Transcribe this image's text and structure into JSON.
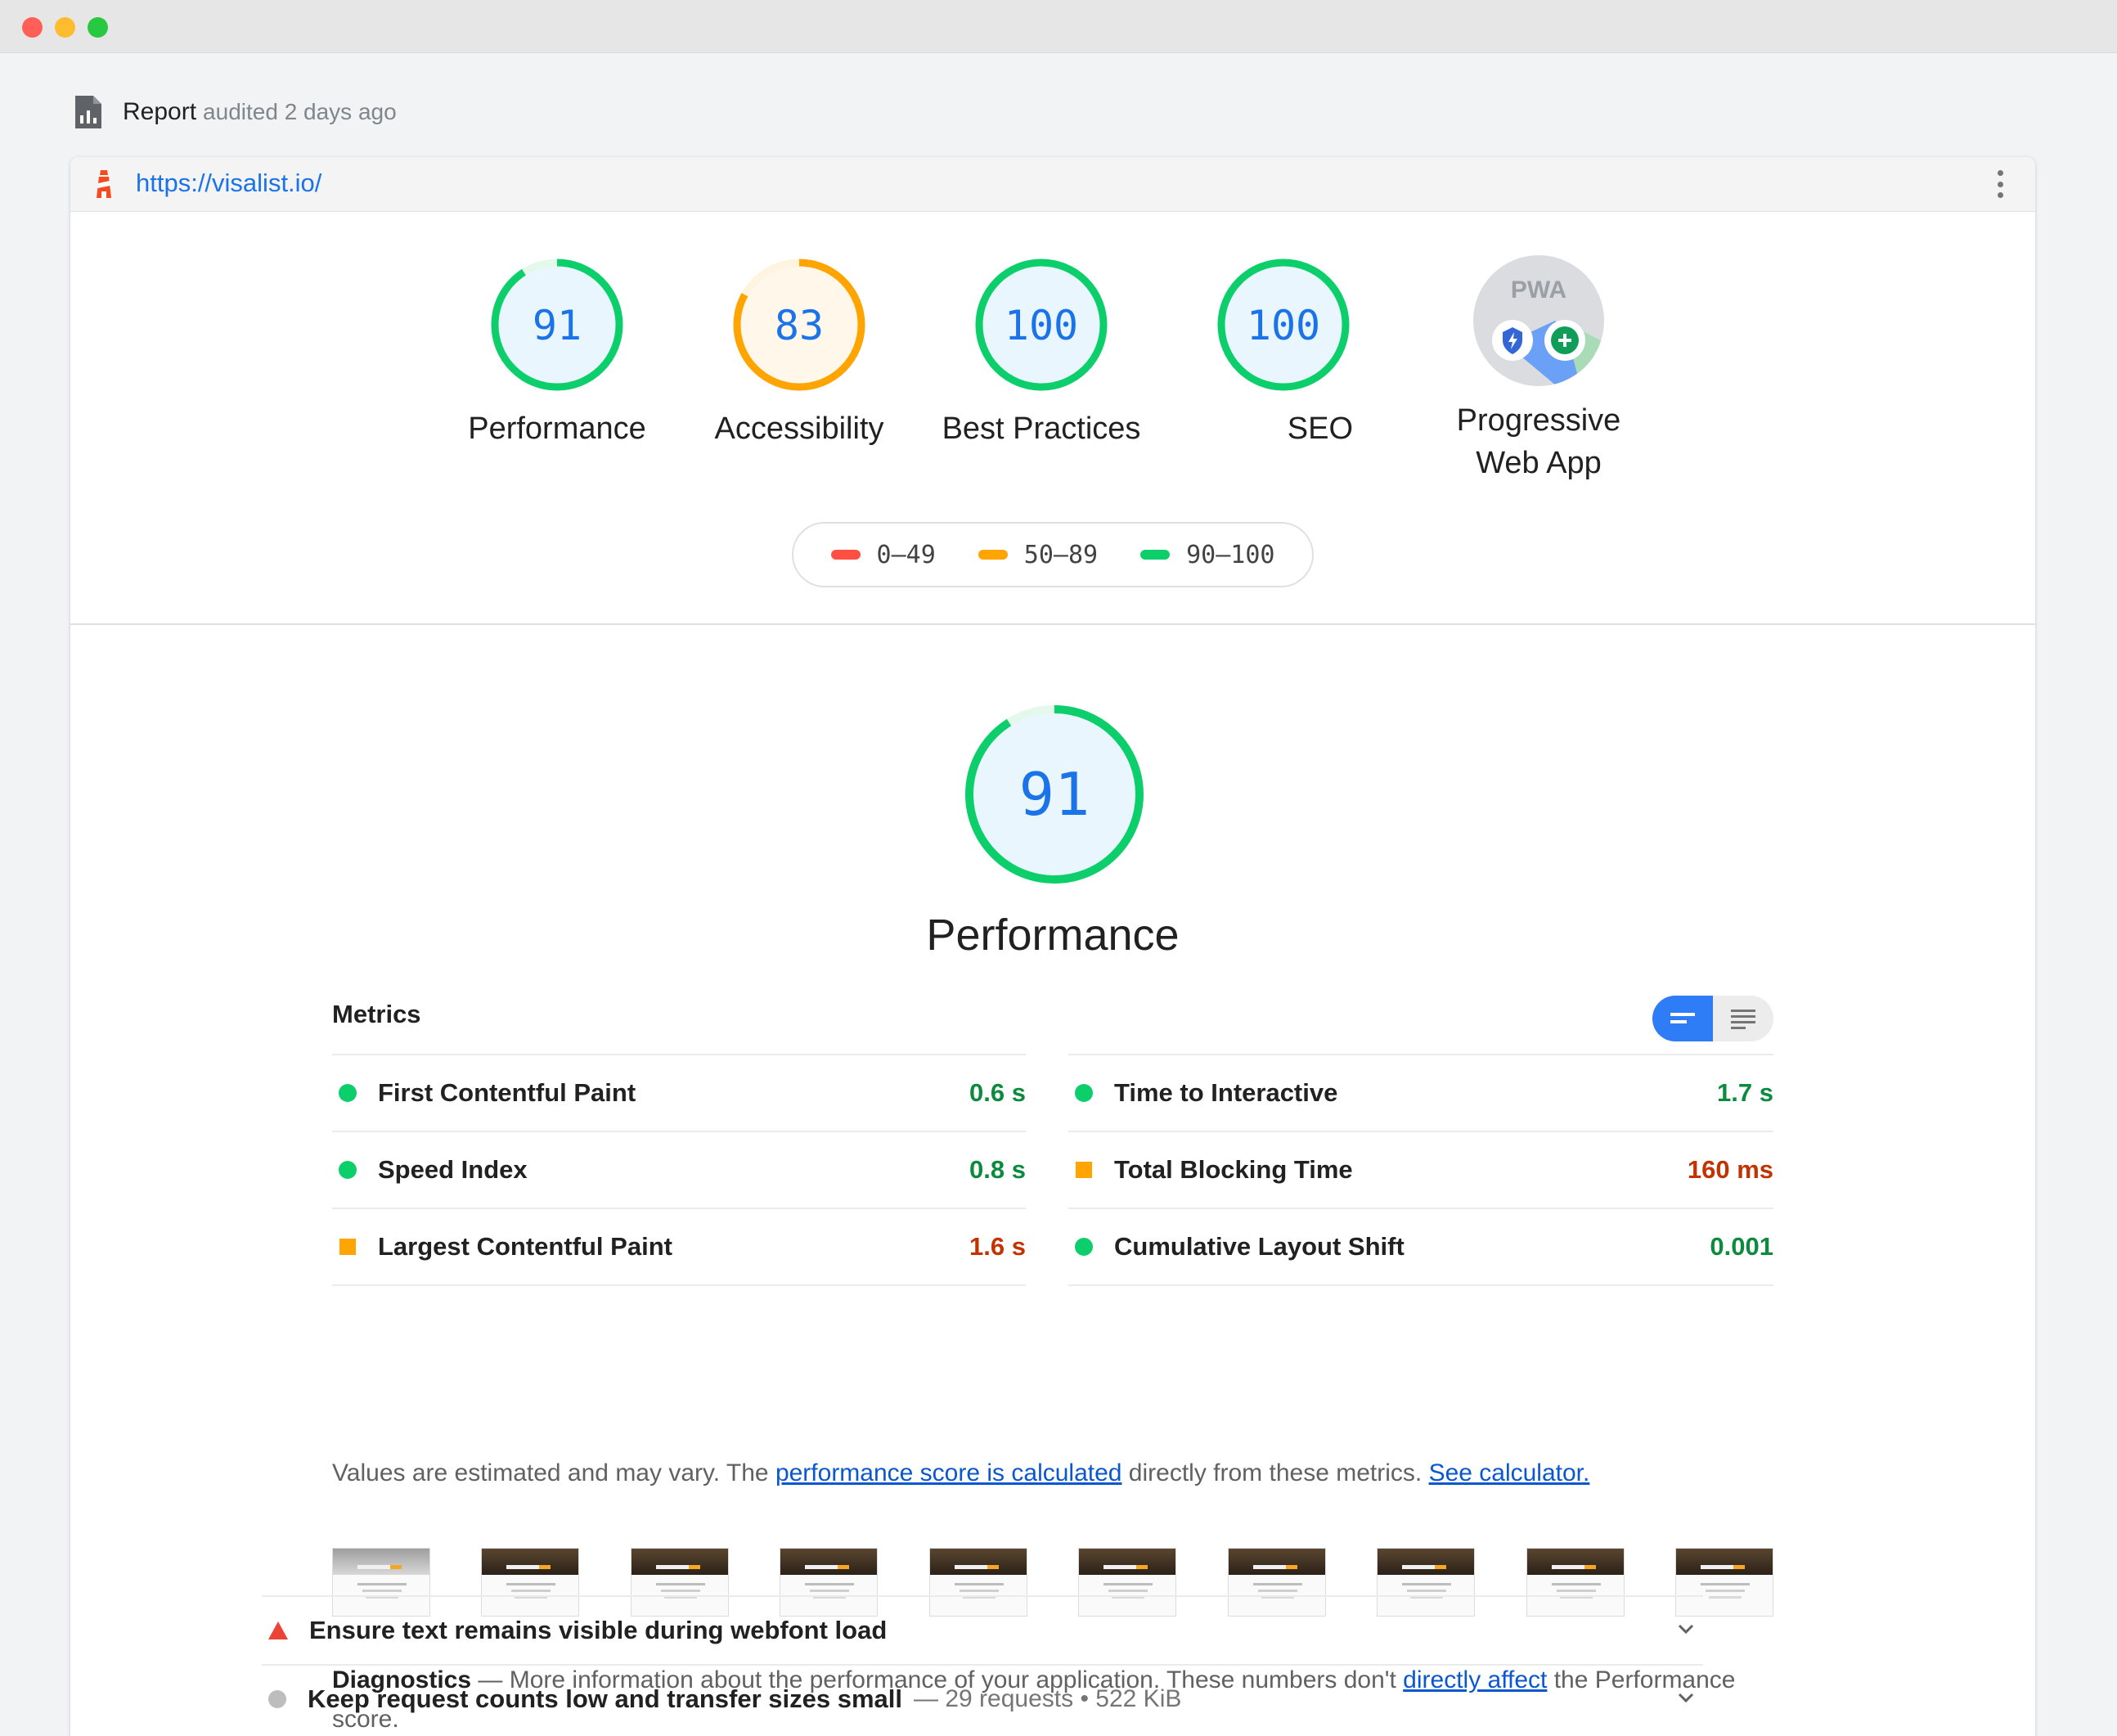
{
  "window": {
    "controls": [
      "close",
      "minimize",
      "maximize"
    ]
  },
  "header": {
    "title": "Report",
    "subtitle": "audited 2 days ago",
    "icon": "report-icon"
  },
  "urlbar": {
    "url": "https://visalist.io/",
    "icon": "lighthouse-icon",
    "menu_icon": "more-vert-icon"
  },
  "scores": [
    {
      "label": "Performance",
      "value": "91",
      "percent": 91,
      "color": "#0cce6b"
    },
    {
      "label": "Accessibility",
      "value": "83",
      "percent": 83,
      "color": "#ffa400"
    },
    {
      "label": "Best Practices",
      "value": "100",
      "percent": 100,
      "color": "#0cce6b"
    },
    {
      "label": "SEO",
      "value": "100",
      "percent": 100,
      "color": "#0cce6b"
    }
  ],
  "pwa": {
    "label_line1": "Progressive",
    "label_line2": "Web App",
    "badge_text": "PWA"
  },
  "legend": [
    {
      "label": "0–49",
      "color": "#ff4e42"
    },
    {
      "label": "50–89",
      "color": "#ffa400"
    },
    {
      "label": "90–100",
      "color": "#0cce6b"
    }
  ],
  "performance": {
    "score": "91",
    "percent": 91,
    "title": "Performance"
  },
  "metrics": {
    "title": "Metrics",
    "left": [
      {
        "name": "First Contentful Paint",
        "value": "0.6 s",
        "status": "pass"
      },
      {
        "name": "Speed Index",
        "value": "0.8 s",
        "status": "pass"
      },
      {
        "name": "Largest Contentful Paint",
        "value": "1.6 s",
        "status": "average"
      }
    ],
    "right": [
      {
        "name": "Time to Interactive",
        "value": "1.7 s",
        "status": "pass"
      },
      {
        "name": "Total Blocking Time",
        "value": "160 ms",
        "status": "average"
      },
      {
        "name": "Cumulative Layout Shift",
        "value": "0.001",
        "status": "pass"
      }
    ]
  },
  "note": {
    "prefix": "Values are estimated and may vary. The ",
    "link1": "performance score is calculated",
    "middle": " directly from these metrics. ",
    "link2": "See calculator."
  },
  "filmstrip_count": 10,
  "diagnostics": {
    "title": "Diagnostics",
    "text_before": " — More information about the performance of your application. These numbers don't ",
    "link": "directly affect",
    "text_after": " the Performance score.",
    "items": [
      {
        "title": "Ensure text remains visible during webfont load",
        "extra": "",
        "status": "fail"
      },
      {
        "title": "Keep request counts low and transfer sizes small",
        "extra": "— 29 requests • 522 KiB",
        "status": "informative"
      }
    ]
  }
}
